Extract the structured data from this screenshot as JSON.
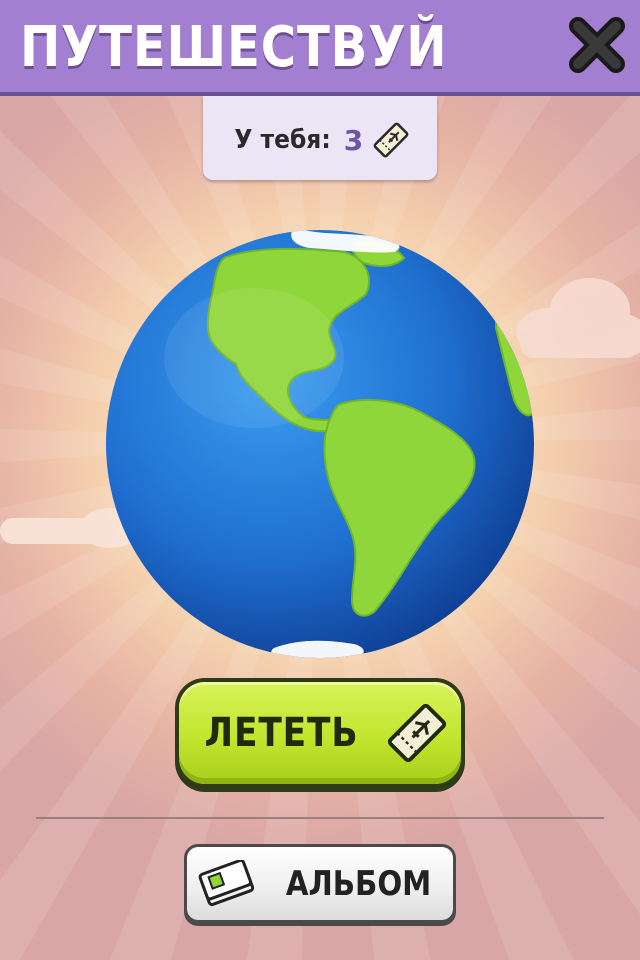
{
  "header": {
    "title": "ПУТЕШЕСТВУЙ",
    "close_icon": "close-x-icon"
  },
  "tickets": {
    "label": "У тебя:",
    "count": "3",
    "icon": "plane-ticket-icon"
  },
  "globe": {
    "icon": "earth-globe-icon"
  },
  "fly_button": {
    "label": "ЛЕТЕТЬ",
    "icon": "plane-ticket-icon"
  },
  "album_button": {
    "label": "АЛЬБОМ",
    "icon": "book-icon"
  },
  "colors": {
    "header": "#a27fd0",
    "fly_button": "#c2e52e",
    "ticket_count": "#6a58a6",
    "ocean": "#1f6fd0",
    "land": "#8fd63a"
  }
}
